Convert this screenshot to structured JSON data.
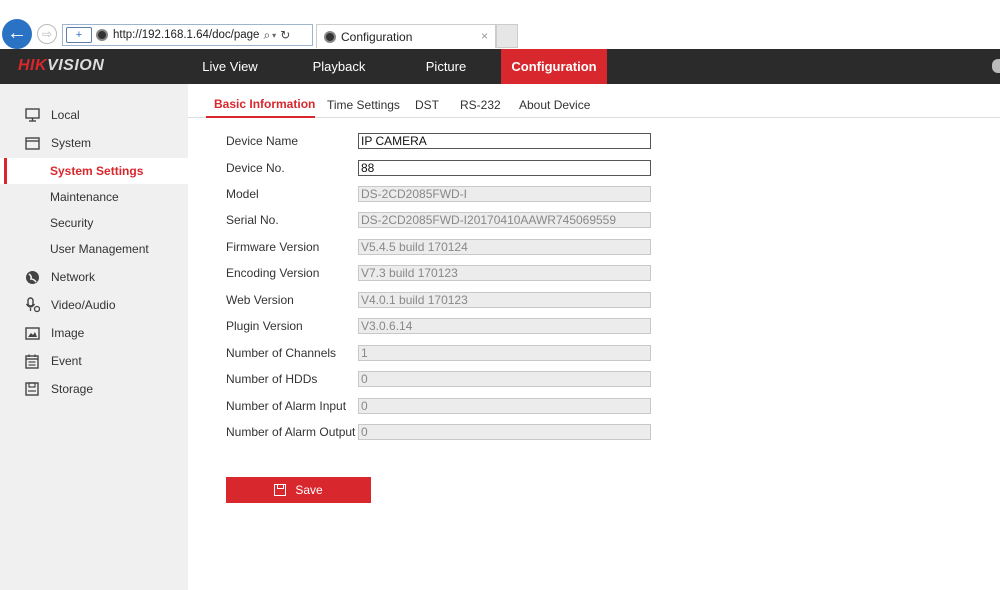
{
  "browser": {
    "url": "http://192.168.1.64/doc/page",
    "tab_title": "Configuration",
    "back_glyph": "←",
    "forward_glyph": "⇨",
    "shield_glyph": "+",
    "search_glyph": "⌕",
    "dropdown_glyph": "▾",
    "refresh_glyph": "↻",
    "close_glyph": "×"
  },
  "header": {
    "logo_part1": "HIK",
    "logo_part2": "VISION",
    "nav": [
      {
        "label": "Live View"
      },
      {
        "label": "Playback"
      },
      {
        "label": "Picture"
      },
      {
        "label": "Configuration"
      }
    ],
    "active_nav": "Configuration"
  },
  "sidebar": {
    "items": [
      {
        "label": "Local",
        "icon": "monitor-icon"
      },
      {
        "label": "System",
        "icon": "system-icon"
      },
      {
        "label": "System Settings",
        "sub": true,
        "active": true
      },
      {
        "label": "Maintenance",
        "sub": true
      },
      {
        "label": "Security",
        "sub": true
      },
      {
        "label": "User Management",
        "sub": true
      },
      {
        "label": "Network",
        "icon": "globe-icon"
      },
      {
        "label": "Video/Audio",
        "icon": "microphone-icon"
      },
      {
        "label": "Image",
        "icon": "image-icon"
      },
      {
        "label": "Event",
        "icon": "calendar-icon"
      },
      {
        "label": "Storage",
        "icon": "storage-icon"
      }
    ]
  },
  "tabs": [
    {
      "label": "Basic Information",
      "active": true
    },
    {
      "label": "Time Settings"
    },
    {
      "label": "DST"
    },
    {
      "label": "RS-232"
    },
    {
      "label": "About Device"
    }
  ],
  "form": {
    "fields": [
      {
        "label": "Device Name",
        "value": "IP CAMERA",
        "editable": true
      },
      {
        "label": "Device No.",
        "value": "88",
        "editable": true
      },
      {
        "label": "Model",
        "value": "DS-2CD2085FWD-I",
        "editable": false
      },
      {
        "label": "Serial No.",
        "value": "DS-2CD2085FWD-I20170410AAWR745069559",
        "editable": false
      },
      {
        "label": "Firmware Version",
        "value": "V5.4.5 build 170124",
        "editable": false
      },
      {
        "label": "Encoding Version",
        "value": "V7.3 build 170123",
        "editable": false
      },
      {
        "label": "Web Version",
        "value": "V4.0.1 build 170123",
        "editable": false
      },
      {
        "label": "Plugin Version",
        "value": "V3.0.6.14",
        "editable": false
      },
      {
        "label": "Number of Channels",
        "value": "1",
        "editable": false
      },
      {
        "label": "Number of HDDs",
        "value": "0",
        "editable": false
      },
      {
        "label": "Number of Alarm Input",
        "value": "0",
        "editable": false
      },
      {
        "label": "Number of Alarm Output",
        "value": "0",
        "editable": false
      }
    ],
    "save_label": "Save"
  },
  "colors": {
    "accent": "#d8272d",
    "nav_bg": "#2b2b2b",
    "sidebar_bg": "#f0f0f0"
  }
}
